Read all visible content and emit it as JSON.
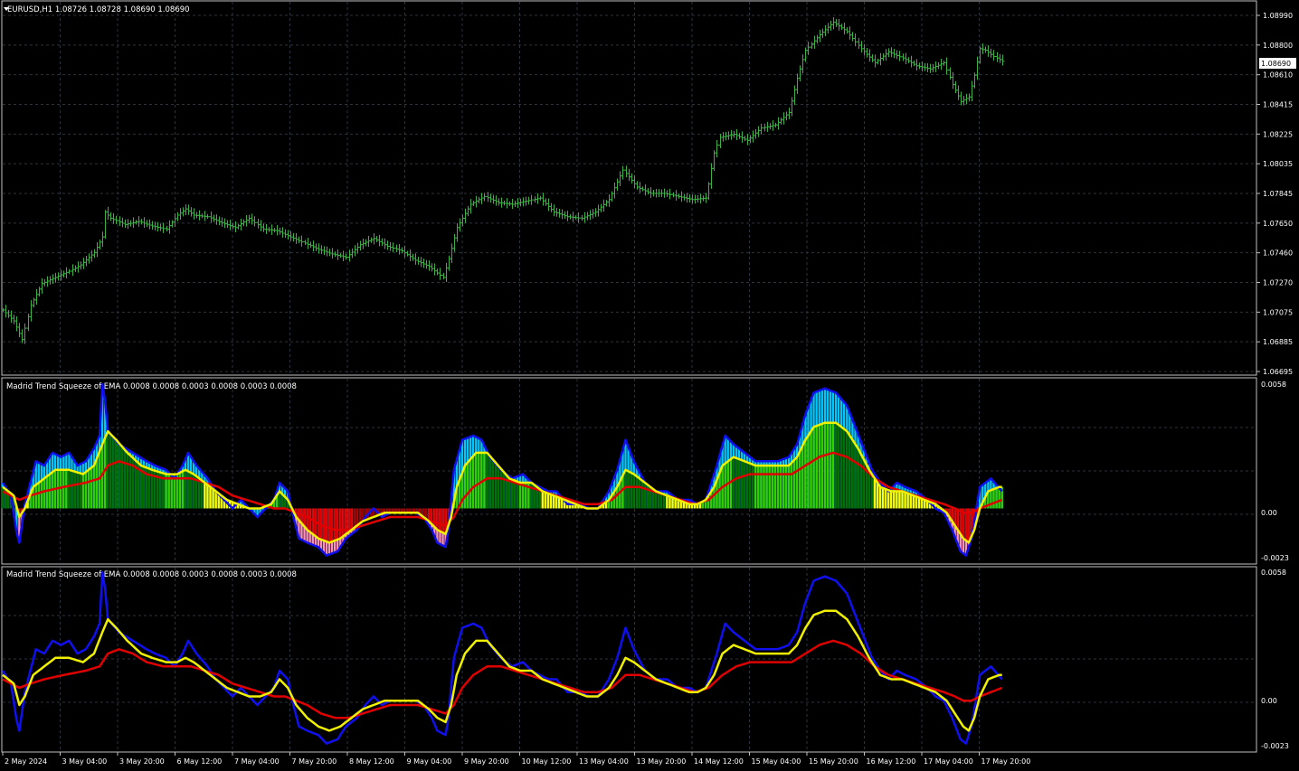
{
  "colors": {
    "background": "#000000",
    "grid": "#2a3340",
    "frame": "#c0c0c0",
    "candle": "#3cb043",
    "blue": "#1010ee",
    "yellow": "#f0f000",
    "red": "#e00000",
    "dark_green": "#007000",
    "light_green": "#32d000",
    "cyan": "#00c8ff",
    "bright_yellow": "#ffff00",
    "maroon": "#9a0000",
    "pink": "#ff90c0"
  },
  "header": {
    "main": "EURUSD,H1  1.08726 1.08728 1.08690 1.08690",
    "sub1": "Madrid Trend Squeeze of EMA  0.0008 0.0008 0.0003 0.0008 0.0003 0.0008",
    "sub2": "Madrid Trend Squeeze of EMA  0.0008 0.0008 0.0003 0.0008 0.0003 0.0008"
  },
  "price_axis": {
    "labels": [
      "1.08990",
      "1.08800",
      "1.08610",
      "1.08415",
      "1.08225",
      "1.08035",
      "1.07845",
      "1.07650",
      "1.07460",
      "1.07270",
      "1.07075",
      "1.06885",
      "1.06695"
    ],
    "current": "1.08690"
  },
  "osc_axis": {
    "top": "0.0058",
    "mid": "0.00",
    "bottom": "-0.0023"
  },
  "time_axis": [
    "2 May 2024",
    "3 May 04:00",
    "3 May 20:00",
    "6 May 12:00",
    "7 May 04:00",
    "7 May 20:00",
    "8 May 12:00",
    "9 May 04:00",
    "9 May 20:00",
    "10 May 12:00",
    "13 May 04:00",
    "13 May 20:00",
    "14 May 12:00",
    "15 May 04:00",
    "15 May 20:00",
    "16 May 12:00",
    "17 May 04:00",
    "17 May 20:00"
  ],
  "chart_data": {
    "type": "line",
    "instrument": "EURUSD,H1",
    "price_range": [
      1.06695,
      1.0899
    ],
    "price_path": [
      [
        0,
        1.0709
      ],
      [
        4,
        1.0702
      ],
      [
        7,
        1.069
      ],
      [
        10,
        1.0712
      ],
      [
        14,
        1.0726
      ],
      [
        19,
        1.073
      ],
      [
        24,
        1.0734
      ],
      [
        28,
        1.0738
      ],
      [
        33,
        1.0746
      ],
      [
        36,
        1.0756
      ],
      [
        37,
        1.0772
      ],
      [
        39,
        1.0768
      ],
      [
        44,
        1.0764
      ],
      [
        49,
        1.0766
      ],
      [
        54,
        1.0763
      ],
      [
        59,
        1.0761
      ],
      [
        63,
        1.077
      ],
      [
        66,
        1.0774
      ],
      [
        69,
        1.077
      ],
      [
        74,
        1.0769
      ],
      [
        79,
        1.0765
      ],
      [
        84,
        1.0762
      ],
      [
        89,
        1.0768
      ],
      [
        94,
        1.0761
      ],
      [
        99,
        1.076
      ],
      [
        104,
        1.0756
      ],
      [
        109,
        1.0752
      ],
      [
        114,
        1.0748
      ],
      [
        119,
        1.0745
      ],
      [
        124,
        1.0743
      ],
      [
        129,
        1.0751
      ],
      [
        134,
        1.0755
      ],
      [
        139,
        1.075
      ],
      [
        144,
        1.0747
      ],
      [
        149,
        1.0741
      ],
      [
        154,
        1.0737
      ],
      [
        159,
        1.073
      ],
      [
        161,
        1.0742
      ],
      [
        164,
        1.0762
      ],
      [
        169,
        1.0777
      ],
      [
        174,
        1.0782
      ],
      [
        179,
        1.0778
      ],
      [
        184,
        1.0777
      ],
      [
        189,
        1.0779
      ],
      [
        194,
        1.0781
      ],
      [
        199,
        1.0772
      ],
      [
        204,
        1.0769
      ],
      [
        209,
        1.0768
      ],
      [
        214,
        1.0772
      ],
      [
        219,
        1.078
      ],
      [
        224,
        1.0799
      ],
      [
        229,
        1.0788
      ],
      [
        234,
        1.0784
      ],
      [
        239,
        1.0784
      ],
      [
        244,
        1.0782
      ],
      [
        249,
        1.078
      ],
      [
        254,
        1.0781
      ],
      [
        255,
        1.079
      ],
      [
        257,
        1.081
      ],
      [
        259,
        1.082
      ],
      [
        264,
        1.0822
      ],
      [
        269,
        1.0818
      ],
      [
        274,
        1.0826
      ],
      [
        279,
        1.0828
      ],
      [
        284,
        1.0836
      ],
      [
        287,
        1.0858
      ],
      [
        290,
        1.0876
      ],
      [
        295,
        1.0886
      ],
      [
        300,
        1.0894
      ],
      [
        305,
        1.0888
      ],
      [
        310,
        1.0877
      ],
      [
        315,
        1.0868
      ],
      [
        320,
        1.0875
      ],
      [
        325,
        1.0871
      ],
      [
        330,
        1.0866
      ],
      [
        335,
        1.0864
      ],
      [
        340,
        1.0868
      ],
      [
        343,
        1.0854
      ],
      [
        346,
        1.0843
      ],
      [
        349,
        1.0846
      ],
      [
        351,
        1.086
      ],
      [
        353,
        1.0877
      ],
      [
        355,
        1.0876
      ],
      [
        358,
        1.0872
      ],
      [
        361,
        1.0869
      ]
    ],
    "osc_range": [
      -0.0023,
      0.0058
    ],
    "blue_line": [
      [
        0,
        0.0012
      ],
      [
        3,
        0.0006
      ],
      [
        5,
        -0.0011
      ],
      [
        6,
        -0.0016
      ],
      [
        8,
        0.0002
      ],
      [
        10,
        0.0012
      ],
      [
        12,
        0.0022
      ],
      [
        15,
        0.002
      ],
      [
        18,
        0.0026
      ],
      [
        21,
        0.0024
      ],
      [
        24,
        0.0026
      ],
      [
        27,
        0.002
      ],
      [
        30,
        0.0022
      ],
      [
        33,
        0.0028
      ],
      [
        35,
        0.0034
      ],
      [
        36,
        0.0058
      ],
      [
        37,
        0.005
      ],
      [
        38,
        0.0036
      ],
      [
        42,
        0.003
      ],
      [
        47,
        0.0026
      ],
      [
        52,
        0.0022
      ],
      [
        55,
        0.002
      ],
      [
        59,
        0.0018
      ],
      [
        62,
        0.0014
      ],
      [
        65,
        0.002
      ],
      [
        67,
        0.0026
      ],
      [
        70,
        0.002
      ],
      [
        74,
        0.0014
      ],
      [
        77,
        0.0008
      ],
      [
        80,
        0.0004
      ],
      [
        83,
        0.0
      ],
      [
        86,
        0.0004
      ],
      [
        89,
        0.0
      ],
      [
        92,
        -0.0004
      ],
      [
        95,
        0.0
      ],
      [
        98,
        0.0004
      ],
      [
        100,
        0.0012
      ],
      [
        103,
        0.0008
      ],
      [
        105,
        -0.0004
      ],
      [
        107,
        -0.0014
      ],
      [
        110,
        -0.0016
      ],
      [
        114,
        -0.0018
      ],
      [
        117,
        -0.0022
      ],
      [
        121,
        -0.002
      ],
      [
        124,
        -0.0014
      ],
      [
        128,
        -0.001
      ],
      [
        131,
        -0.0004
      ],
      [
        134,
        0.0
      ],
      [
        137,
        -0.0004
      ],
      [
        140,
        -0.0002
      ],
      [
        143,
        -0.0002
      ],
      [
        146,
        -0.0002
      ],
      [
        149,
        -0.0002
      ],
      [
        152,
        -0.0004
      ],
      [
        155,
        -0.001
      ],
      [
        157,
        -0.0016
      ],
      [
        160,
        -0.0018
      ],
      [
        161,
        -0.001
      ],
      [
        163,
        0.0018
      ],
      [
        166,
        0.0032
      ],
      [
        170,
        0.0034
      ],
      [
        173,
        0.0032
      ],
      [
        176,
        0.0024
      ],
      [
        180,
        0.0018
      ],
      [
        184,
        0.0014
      ],
      [
        188,
        0.0016
      ],
      [
        191,
        0.0012
      ],
      [
        194,
        0.001
      ],
      [
        197,
        0.0008
      ],
      [
        200,
        0.0008
      ],
      [
        204,
        0.0002
      ],
      [
        208,
        0.0002
      ],
      [
        212,
        0.0
      ],
      [
        215,
        0.0
      ],
      [
        219,
        0.0008
      ],
      [
        222,
        0.0018
      ],
      [
        225,
        0.0032
      ],
      [
        228,
        0.0022
      ],
      [
        232,
        0.0012
      ],
      [
        236,
        0.0008
      ],
      [
        240,
        0.0008
      ],
      [
        244,
        0.0004
      ],
      [
        248,
        0.0004
      ],
      [
        251,
        0.0002
      ],
      [
        254,
        0.0004
      ],
      [
        256,
        0.0012
      ],
      [
        258,
        0.002
      ],
      [
        261,
        0.0034
      ],
      [
        264,
        0.003
      ],
      [
        268,
        0.0026
      ],
      [
        272,
        0.0022
      ],
      [
        276,
        0.0022
      ],
      [
        280,
        0.0022
      ],
      [
        284,
        0.0024
      ],
      [
        287,
        0.003
      ],
      [
        290,
        0.0044
      ],
      [
        293,
        0.0054
      ],
      [
        297,
        0.0056
      ],
      [
        301,
        0.0054
      ],
      [
        305,
        0.0048
      ],
      [
        308,
        0.0038
      ],
      [
        311,
        0.0028
      ],
      [
        314,
        0.0018
      ],
      [
        317,
        0.0012
      ],
      [
        320,
        0.0008
      ],
      [
        323,
        0.0012
      ],
      [
        326,
        0.001
      ],
      [
        330,
        0.0008
      ],
      [
        334,
        0.0004
      ],
      [
        337,
        0.0
      ],
      [
        340,
        -0.0002
      ],
      [
        343,
        -0.001
      ],
      [
        346,
        -0.002
      ],
      [
        348,
        -0.0022
      ],
      [
        350,
        -0.0014
      ],
      [
        353,
        0.001
      ],
      [
        357,
        0.0014
      ],
      [
        361,
        0.0008
      ]
    ],
    "yellow_line": [
      [
        0,
        0.001
      ],
      [
        4,
        0.0006
      ],
      [
        6,
        -0.0004
      ],
      [
        8,
        0.0
      ],
      [
        11,
        0.001
      ],
      [
        15,
        0.0014
      ],
      [
        19,
        0.0018
      ],
      [
        24,
        0.0018
      ],
      [
        29,
        0.0016
      ],
      [
        33,
        0.002
      ],
      [
        36,
        0.003
      ],
      [
        38,
        0.0036
      ],
      [
        41,
        0.0032
      ],
      [
        45,
        0.0026
      ],
      [
        50,
        0.002
      ],
      [
        54,
        0.0018
      ],
      [
        59,
        0.0016
      ],
      [
        63,
        0.0016
      ],
      [
        66,
        0.0018
      ],
      [
        69,
        0.0016
      ],
      [
        73,
        0.0012
      ],
      [
        77,
        0.0008
      ],
      [
        81,
        0.0004
      ],
      [
        85,
        0.0002
      ],
      [
        89,
        0.0
      ],
      [
        93,
        0.0
      ],
      [
        97,
        0.0002
      ],
      [
        100,
        0.0008
      ],
      [
        103,
        0.0004
      ],
      [
        106,
        -0.0004
      ],
      [
        110,
        -0.001
      ],
      [
        114,
        -0.0014
      ],
      [
        118,
        -0.0016
      ],
      [
        122,
        -0.0014
      ],
      [
        126,
        -0.001
      ],
      [
        130,
        -0.0006
      ],
      [
        134,
        -0.0004
      ],
      [
        138,
        -0.0002
      ],
      [
        142,
        -0.0002
      ],
      [
        146,
        -0.0002
      ],
      [
        150,
        -0.0002
      ],
      [
        154,
        -0.0006
      ],
      [
        157,
        -0.001
      ],
      [
        160,
        -0.0012
      ],
      [
        162,
        -0.0004
      ],
      [
        164,
        0.001
      ],
      [
        167,
        0.002
      ],
      [
        171,
        0.0026
      ],
      [
        175,
        0.0026
      ],
      [
        179,
        0.002
      ],
      [
        183,
        0.0014
      ],
      [
        187,
        0.0012
      ],
      [
        191,
        0.0012
      ],
      [
        195,
        0.0008
      ],
      [
        199,
        0.0006
      ],
      [
        203,
        0.0004
      ],
      [
        207,
        0.0002
      ],
      [
        211,
        0.0
      ],
      [
        215,
        0.0
      ],
      [
        219,
        0.0004
      ],
      [
        222,
        0.001
      ],
      [
        225,
        0.0018
      ],
      [
        228,
        0.0016
      ],
      [
        232,
        0.0012
      ],
      [
        236,
        0.0008
      ],
      [
        240,
        0.0006
      ],
      [
        244,
        0.0004
      ],
      [
        248,
        0.0002
      ],
      [
        251,
        0.0002
      ],
      [
        254,
        0.0004
      ],
      [
        257,
        0.001
      ],
      [
        260,
        0.002
      ],
      [
        264,
        0.0024
      ],
      [
        268,
        0.0022
      ],
      [
        272,
        0.002
      ],
      [
        276,
        0.002
      ],
      [
        280,
        0.002
      ],
      [
        284,
        0.002
      ],
      [
        287,
        0.0024
      ],
      [
        290,
        0.0032
      ],
      [
        293,
        0.0038
      ],
      [
        297,
        0.004
      ],
      [
        301,
        0.004
      ],
      [
        305,
        0.0036
      ],
      [
        309,
        0.0028
      ],
      [
        313,
        0.0018
      ],
      [
        317,
        0.001
      ],
      [
        321,
        0.0008
      ],
      [
        325,
        0.0008
      ],
      [
        329,
        0.0006
      ],
      [
        333,
        0.0004
      ],
      [
        337,
        0.0002
      ],
      [
        341,
        -0.0002
      ],
      [
        344,
        -0.0008
      ],
      [
        347,
        -0.0014
      ],
      [
        349,
        -0.0016
      ],
      [
        351,
        -0.001
      ],
      [
        353,
        0.0
      ],
      [
        356,
        0.0008
      ],
      [
        360,
        0.001
      ]
    ],
    "red_line": [
      [
        0,
        0.0008
      ],
      [
        6,
        0.0004
      ],
      [
        10,
        0.0006
      ],
      [
        15,
        0.0008
      ],
      [
        22,
        0.001
      ],
      [
        30,
        0.0012
      ],
      [
        35,
        0.0014
      ],
      [
        38,
        0.002
      ],
      [
        42,
        0.0022
      ],
      [
        47,
        0.002
      ],
      [
        52,
        0.0016
      ],
      [
        58,
        0.0014
      ],
      [
        63,
        0.0014
      ],
      [
        68,
        0.0014
      ],
      [
        73,
        0.0012
      ],
      [
        78,
        0.001
      ],
      [
        83,
        0.0006
      ],
      [
        88,
        0.0004
      ],
      [
        93,
        0.0002
      ],
      [
        98,
        0.0
      ],
      [
        102,
        0.0
      ],
      [
        106,
        -0.0002
      ],
      [
        110,
        -0.0004
      ],
      [
        115,
        -0.0008
      ],
      [
        120,
        -0.001
      ],
      [
        125,
        -0.001
      ],
      [
        130,
        -0.0008
      ],
      [
        135,
        -0.0006
      ],
      [
        140,
        -0.0004
      ],
      [
        145,
        -0.0004
      ],
      [
        150,
        -0.0004
      ],
      [
        155,
        -0.0006
      ],
      [
        160,
        -0.0008
      ],
      [
        163,
        -0.0004
      ],
      [
        166,
        0.0004
      ],
      [
        170,
        0.001
      ],
      [
        175,
        0.0014
      ],
      [
        180,
        0.0014
      ],
      [
        185,
        0.0012
      ],
      [
        190,
        0.001
      ],
      [
        195,
        0.0008
      ],
      [
        200,
        0.0006
      ],
      [
        205,
        0.0004
      ],
      [
        210,
        0.0002
      ],
      [
        215,
        0.0002
      ],
      [
        220,
        0.0004
      ],
      [
        225,
        0.001
      ],
      [
        230,
        0.001
      ],
      [
        235,
        0.0008
      ],
      [
        240,
        0.0006
      ],
      [
        245,
        0.0004
      ],
      [
        250,
        0.0002
      ],
      [
        255,
        0.0004
      ],
      [
        260,
        0.001
      ],
      [
        265,
        0.0014
      ],
      [
        270,
        0.0016
      ],
      [
        275,
        0.0016
      ],
      [
        280,
        0.0016
      ],
      [
        285,
        0.0016
      ],
      [
        290,
        0.002
      ],
      [
        295,
        0.0024
      ],
      [
        300,
        0.0026
      ],
      [
        305,
        0.0024
      ],
      [
        310,
        0.002
      ],
      [
        315,
        0.0014
      ],
      [
        320,
        0.001
      ],
      [
        325,
        0.0008
      ],
      [
        330,
        0.0006
      ],
      [
        335,
        0.0004
      ],
      [
        340,
        0.0002
      ],
      [
        344,
        0.0
      ],
      [
        347,
        -0.0002
      ],
      [
        350,
        -0.0002
      ],
      [
        353,
        0.0
      ],
      [
        357,
        0.0002
      ],
      [
        361,
        0.0004
      ]
    ]
  }
}
